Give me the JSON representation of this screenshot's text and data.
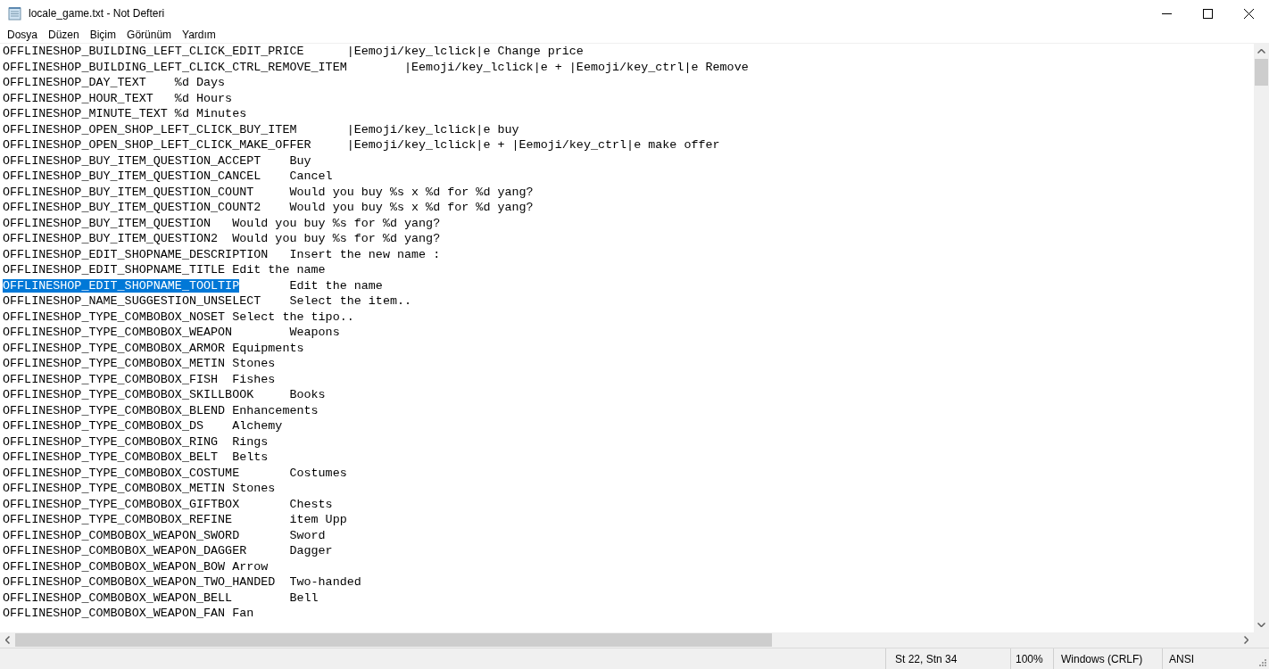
{
  "window": {
    "title": "locale_game.txt - Not Defteri"
  },
  "menu": [
    "Dosya",
    "Düzen",
    "Biçim",
    "Görünüm",
    "Yardım"
  ],
  "lines": [
    {
      "key": "OFFLINESHOP_BUILDING_LEFT_CLICK_EDIT_PRICE",
      "value": "|Eemoji/key_lclick|e Change price",
      "selected": false
    },
    {
      "key": "OFFLINESHOP_BUILDING_LEFT_CLICK_CTRL_REMOVE_ITEM",
      "value": "|Eemoji/key_lclick|e + |Eemoji/key_ctrl|e Remove",
      "selected": false
    },
    {
      "key": "OFFLINESHOP_DAY_TEXT",
      "value": "%d Days",
      "selected": false
    },
    {
      "key": "OFFLINESHOP_HOUR_TEXT",
      "value": "%d Hours",
      "selected": false
    },
    {
      "key": "OFFLINESHOP_MINUTE_TEXT",
      "value": "%d Minutes",
      "selected": false
    },
    {
      "key": "OFFLINESHOP_OPEN_SHOP_LEFT_CLICK_BUY_ITEM",
      "value": "|Eemoji/key_lclick|e buy",
      "selected": false
    },
    {
      "key": "OFFLINESHOP_OPEN_SHOP_LEFT_CLICK_MAKE_OFFER",
      "value": "|Eemoji/key_lclick|e + |Eemoji/key_ctrl|e make offer",
      "selected": false
    },
    {
      "key": "OFFLINESHOP_BUY_ITEM_QUESTION_ACCEPT",
      "value": "Buy",
      "selected": false
    },
    {
      "key": "OFFLINESHOP_BUY_ITEM_QUESTION_CANCEL",
      "value": "Cancel",
      "selected": false
    },
    {
      "key": "OFFLINESHOP_BUY_ITEM_QUESTION_COUNT",
      "value": "Would you buy %s x %d for %d yang?",
      "selected": false
    },
    {
      "key": "OFFLINESHOP_BUY_ITEM_QUESTION_COUNT2",
      "value": "Would you buy %s x %d for %d yang?",
      "selected": false
    },
    {
      "key": "OFFLINESHOP_BUY_ITEM_QUESTION",
      "value": "Would you buy %s for %d yang?",
      "selected": false
    },
    {
      "key": "OFFLINESHOP_BUY_ITEM_QUESTION2",
      "value": "Would you buy %s for %d yang?",
      "selected": false
    },
    {
      "key": "OFFLINESHOP_EDIT_SHOPNAME_DESCRIPTION",
      "value": "Insert the new name :",
      "selected": false
    },
    {
      "key": "OFFLINESHOP_EDIT_SHOPNAME_TITLE",
      "value": "Edit the name",
      "selected": false
    },
    {
      "key": "OFFLINESHOP_EDIT_SHOPNAME_TOOLTIP",
      "value": "Edit the name",
      "selected": true
    },
    {
      "key": "OFFLINESHOP_NAME_SUGGESTION_UNSELECT",
      "value": "Select the item..",
      "selected": false
    },
    {
      "key": "OFFLINESHOP_TYPE_COMBOBOX_NOSET",
      "value": "Select the tipo..",
      "selected": false
    },
    {
      "key": "OFFLINESHOP_TYPE_COMBOBOX_WEAPON",
      "value": "Weapons",
      "selected": false
    },
    {
      "key": "OFFLINESHOP_TYPE_COMBOBOX_ARMOR",
      "value": "Equipments",
      "selected": false
    },
    {
      "key": "OFFLINESHOP_TYPE_COMBOBOX_METIN",
      "value": "Stones",
      "selected": false
    },
    {
      "key": "OFFLINESHOP_TYPE_COMBOBOX_FISH",
      "value": "Fishes",
      "selected": false
    },
    {
      "key": "OFFLINESHOP_TYPE_COMBOBOX_SKILLBOOK",
      "value": "Books",
      "selected": false
    },
    {
      "key": "OFFLINESHOP_TYPE_COMBOBOX_BLEND",
      "value": "Enhancements",
      "selected": false
    },
    {
      "key": "OFFLINESHOP_TYPE_COMBOBOX_DS",
      "value": "Alchemy",
      "selected": false
    },
    {
      "key": "OFFLINESHOP_TYPE_COMBOBOX_RING",
      "value": "Rings",
      "selected": false
    },
    {
      "key": "OFFLINESHOP_TYPE_COMBOBOX_BELT",
      "value": "Belts",
      "selected": false
    },
    {
      "key": "OFFLINESHOP_TYPE_COMBOBOX_COSTUME",
      "value": "Costumes",
      "selected": false
    },
    {
      "key": "OFFLINESHOP_TYPE_COMBOBOX_METIN",
      "value": "Stones",
      "selected": false
    },
    {
      "key": "OFFLINESHOP_TYPE_COMBOBOX_GIFTBOX",
      "value": "Chests",
      "selected": false
    },
    {
      "key": "OFFLINESHOP_TYPE_COMBOBOX_REFINE",
      "value": "item Upp",
      "selected": false
    },
    {
      "key": "OFFLINESHOP_COMBOBOX_WEAPON_SWORD",
      "value": "Sword",
      "selected": false
    },
    {
      "key": "OFFLINESHOP_COMBOBOX_WEAPON_DAGGER",
      "value": "Dagger",
      "selected": false
    },
    {
      "key": "OFFLINESHOP_COMBOBOX_WEAPON_BOW",
      "value": "Arrow",
      "selected": false
    },
    {
      "key": "OFFLINESHOP_COMBOBOX_WEAPON_TWO_HANDED",
      "value": "Two-handed",
      "selected": false
    },
    {
      "key": "OFFLINESHOP_COMBOBOX_WEAPON_BELL",
      "value": "Bell",
      "selected": false
    },
    {
      "key": "OFFLINESHOP_COMBOBOX_WEAPON_FAN",
      "value": "Fan",
      "selected": false
    }
  ],
  "status_bar": {
    "position": "St 22, Stn 34",
    "zoom": "100%",
    "line_ending": "Windows (CRLF)",
    "encoding": "ANSI"
  }
}
